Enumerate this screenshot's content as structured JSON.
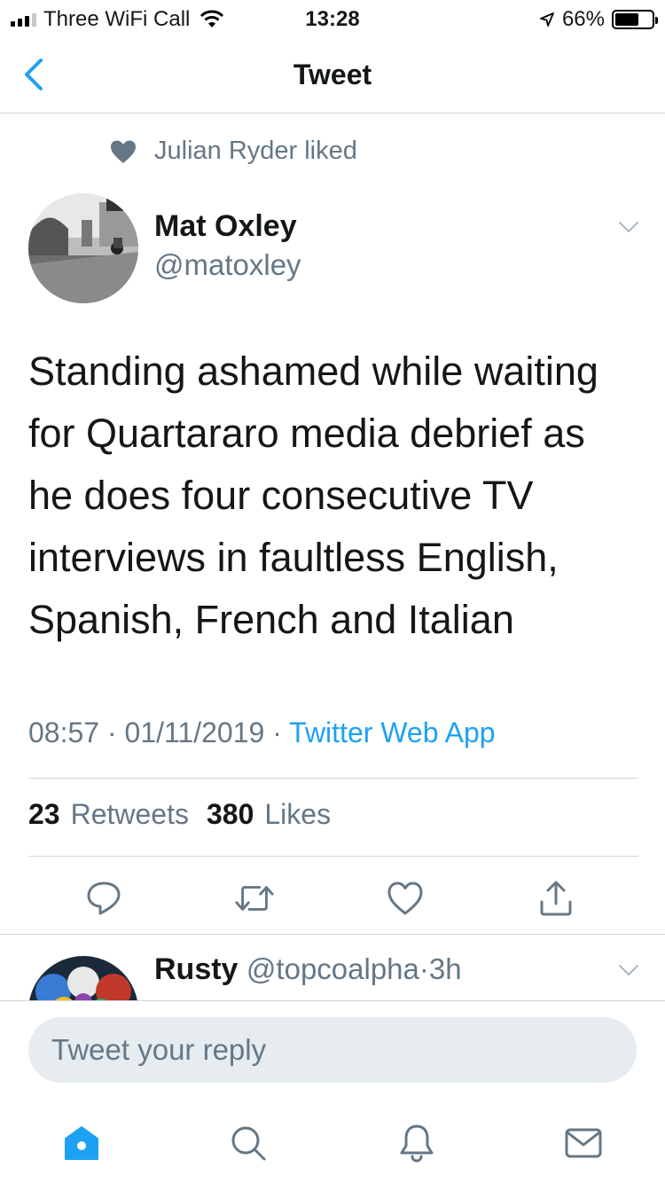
{
  "status_bar": {
    "carrier": "Three WiFi Call",
    "time": "13:28",
    "battery_percent": "66%",
    "battery_level": 0.66
  },
  "nav": {
    "title": "Tweet",
    "back_icon": "chevron-left-icon"
  },
  "tweet": {
    "social_context": "Julian Ryder liked",
    "author_name": "Mat Oxley",
    "author_handle": "@matoxley",
    "text": "Standing ashamed while waiting for Quartararo media debrief as he does four consecutive TV interviews in faultless English, Spanish, French and Italian",
    "time": "08:57",
    "date": "01/11/2019",
    "separator": "·",
    "source": "Twitter Web App",
    "retweets_count": "23",
    "retweets_label": "Retweets",
    "likes_count": "380",
    "likes_label": "Likes",
    "actions": [
      "reply-icon",
      "retweet-icon",
      "like-icon",
      "share-icon"
    ]
  },
  "reply": {
    "author_name": "Rusty",
    "author_handle": "@topcoalpha",
    "separator": "·",
    "time": "3h"
  },
  "compose": {
    "placeholder": "Tweet your reply"
  },
  "tabbar": {
    "tabs": [
      "home-icon",
      "search-icon",
      "notifications-icon",
      "messages-icon"
    ],
    "active": "home-icon"
  },
  "colors": {
    "accent": "#1da1f2",
    "secondary_text": "#657786",
    "primary_text": "#14171a",
    "divider": "#d0d6db",
    "input_bg": "#e6ecf0"
  }
}
